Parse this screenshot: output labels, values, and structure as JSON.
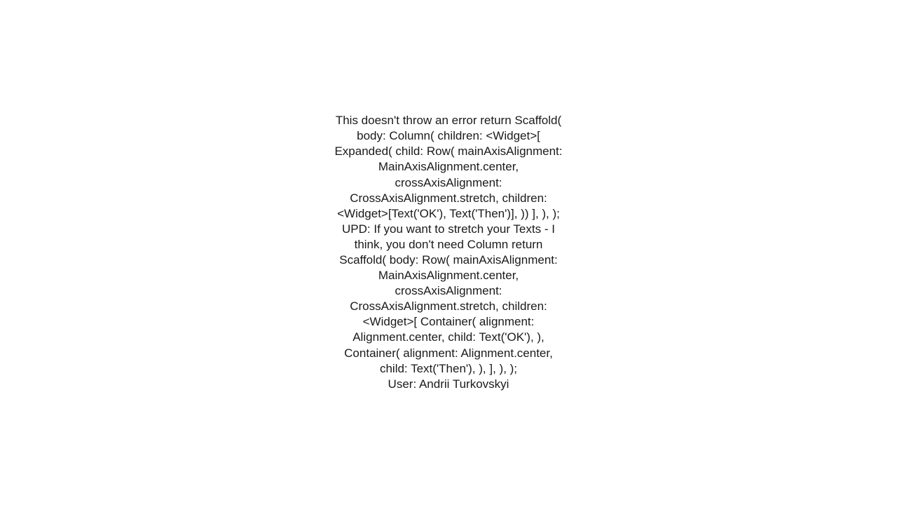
{
  "post": {
    "body": "This doesn't throw an error return Scaffold(   body: Column(     children: <Widget>[       Expanded(           child: Row(         mainAxisAlignment: MainAxisAlignment.center,         crossAxisAlignment: CrossAxisAlignment.stretch,         children: <Widget>[Text('OK'), Text('Then')],       ))     ],   ), );   UPD: If you want to stretch your Texts - I think, you don't need Column return Scaffold(   body: Row(     mainAxisAlignment: MainAxisAlignment.center,     crossAxisAlignment: CrossAxisAlignment.stretch,     children: <Widget>[       Container(         alignment: Alignment.center,         child: Text('OK'),       ),       Container(         alignment: Alignment.center,         child: Text('Then'),       ),     ],   ), );",
    "user_label": "User: ",
    "user_name": "Andrii Turkovskyi"
  }
}
